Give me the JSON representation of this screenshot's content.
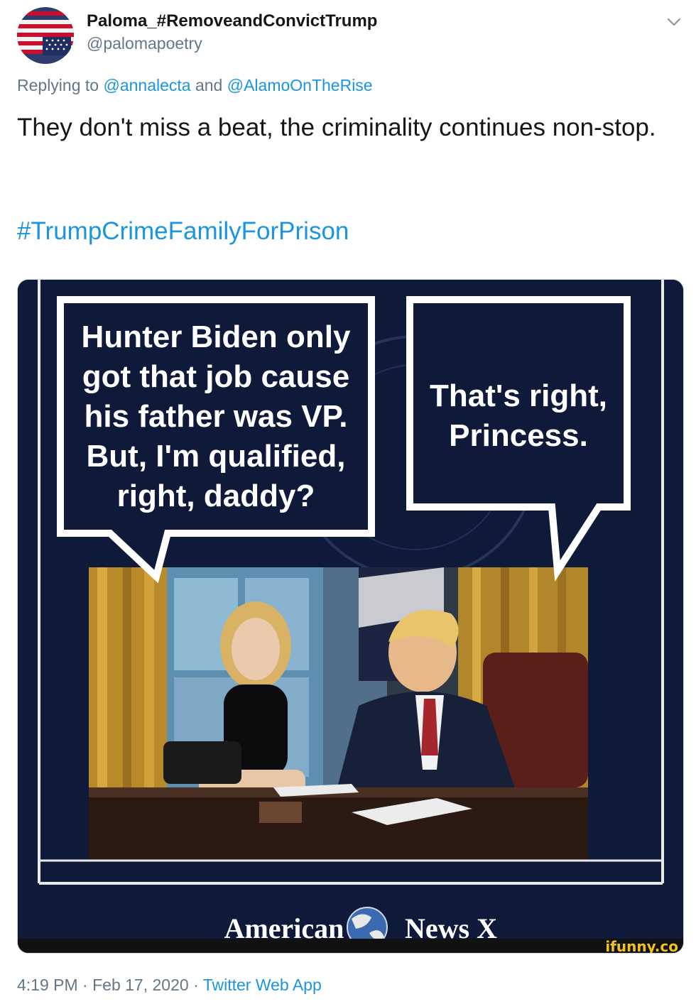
{
  "tweet": {
    "display_name": "Paloma_#RemoveandConvictTrump",
    "handle": "@palomapoetry",
    "reply_prefix": "Replying to",
    "reply_user1": "@annalecta",
    "reply_and": "and",
    "reply_user2": "@AlamoOnTheRise",
    "text": "They don't miss a beat, the criminality continues non-stop.",
    "hashtag": "#TrumpCrimeFamilyForPrison",
    "time": "4:19 PM",
    "sep": "·",
    "date": "Feb 17, 2020",
    "source": "Twitter Web App"
  },
  "meme": {
    "bubble_left": [
      "Hunter Biden only",
      "got that job cause",
      "his father was VP.",
      "But, I'm qualified,",
      "right, daddy?"
    ],
    "bubble_right": [
      "That's right,",
      "Princess."
    ],
    "brand_left": "American",
    "brand_right": "News X",
    "watermark": "ifunny.co"
  },
  "icons": {
    "avatar": "us-flag-avatar",
    "menu": "chevron-down-icon",
    "globe": "globe-icon"
  },
  "colors": {
    "link": "#1b95e0",
    "secondary": "#657786",
    "navy": "#0f1a3a",
    "watermark": "#f4c21a"
  }
}
